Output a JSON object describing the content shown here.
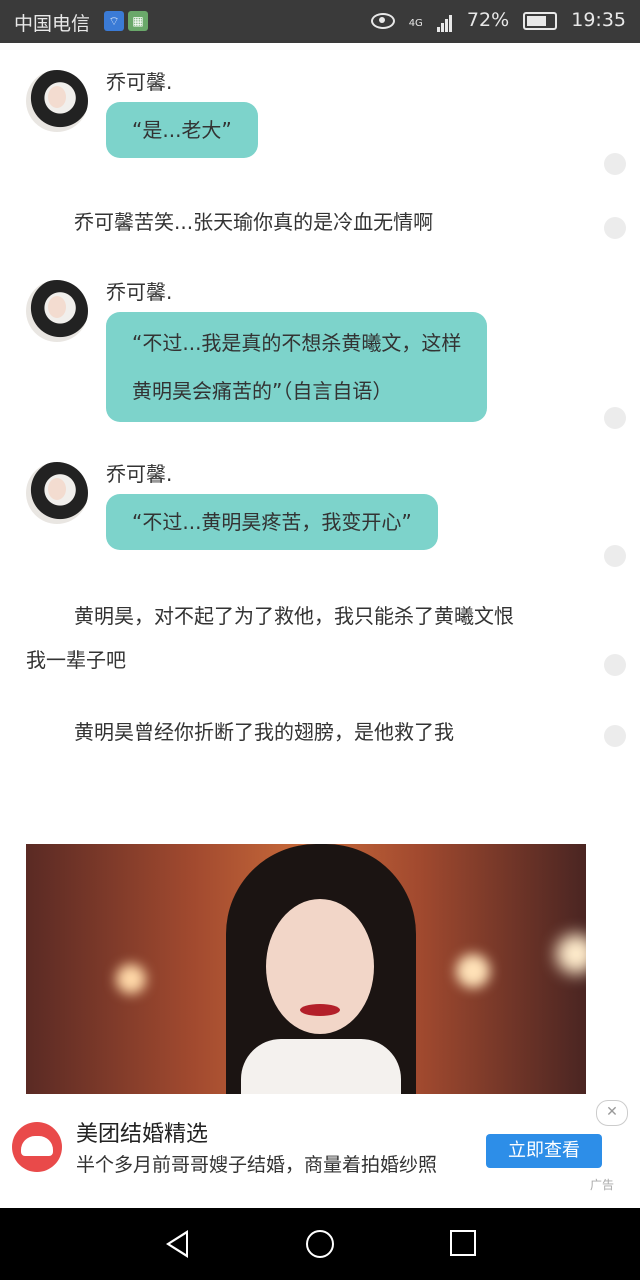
{
  "status_bar": {
    "carrier": "中国电信",
    "network": "4G",
    "battery": "72%",
    "time": "19:35"
  },
  "messages": [
    {
      "type": "chat",
      "sender": "乔可馨.",
      "text": "“是...老大”"
    },
    {
      "type": "narration",
      "text": "乔可馨苦笑...张天瑜你真的是冷血无情啊"
    },
    {
      "type": "chat",
      "sender": "乔可馨.",
      "line1": "“不过...我是真的不想杀黄曦文，这样",
      "line2": "黄明昊会痛苦的”（自言自语）"
    },
    {
      "type": "chat",
      "sender": "乔可馨.",
      "text": "“不过...黄明昊疼苦，我变开心”"
    },
    {
      "type": "narration",
      "line1": "黄明昊，对不起了为了救他，我只能杀了黄曦文恨",
      "line2": "我一辈子吧"
    },
    {
      "type": "narration",
      "text": "黄明昊曾经你折断了我的翅膀，是他救了我"
    }
  ],
  "ad": {
    "title": "美团结婚精选",
    "description": "半个多月前哥哥嫂子结婚，商量着拍婚纱照",
    "cta": "立即查看",
    "label": "广告"
  }
}
